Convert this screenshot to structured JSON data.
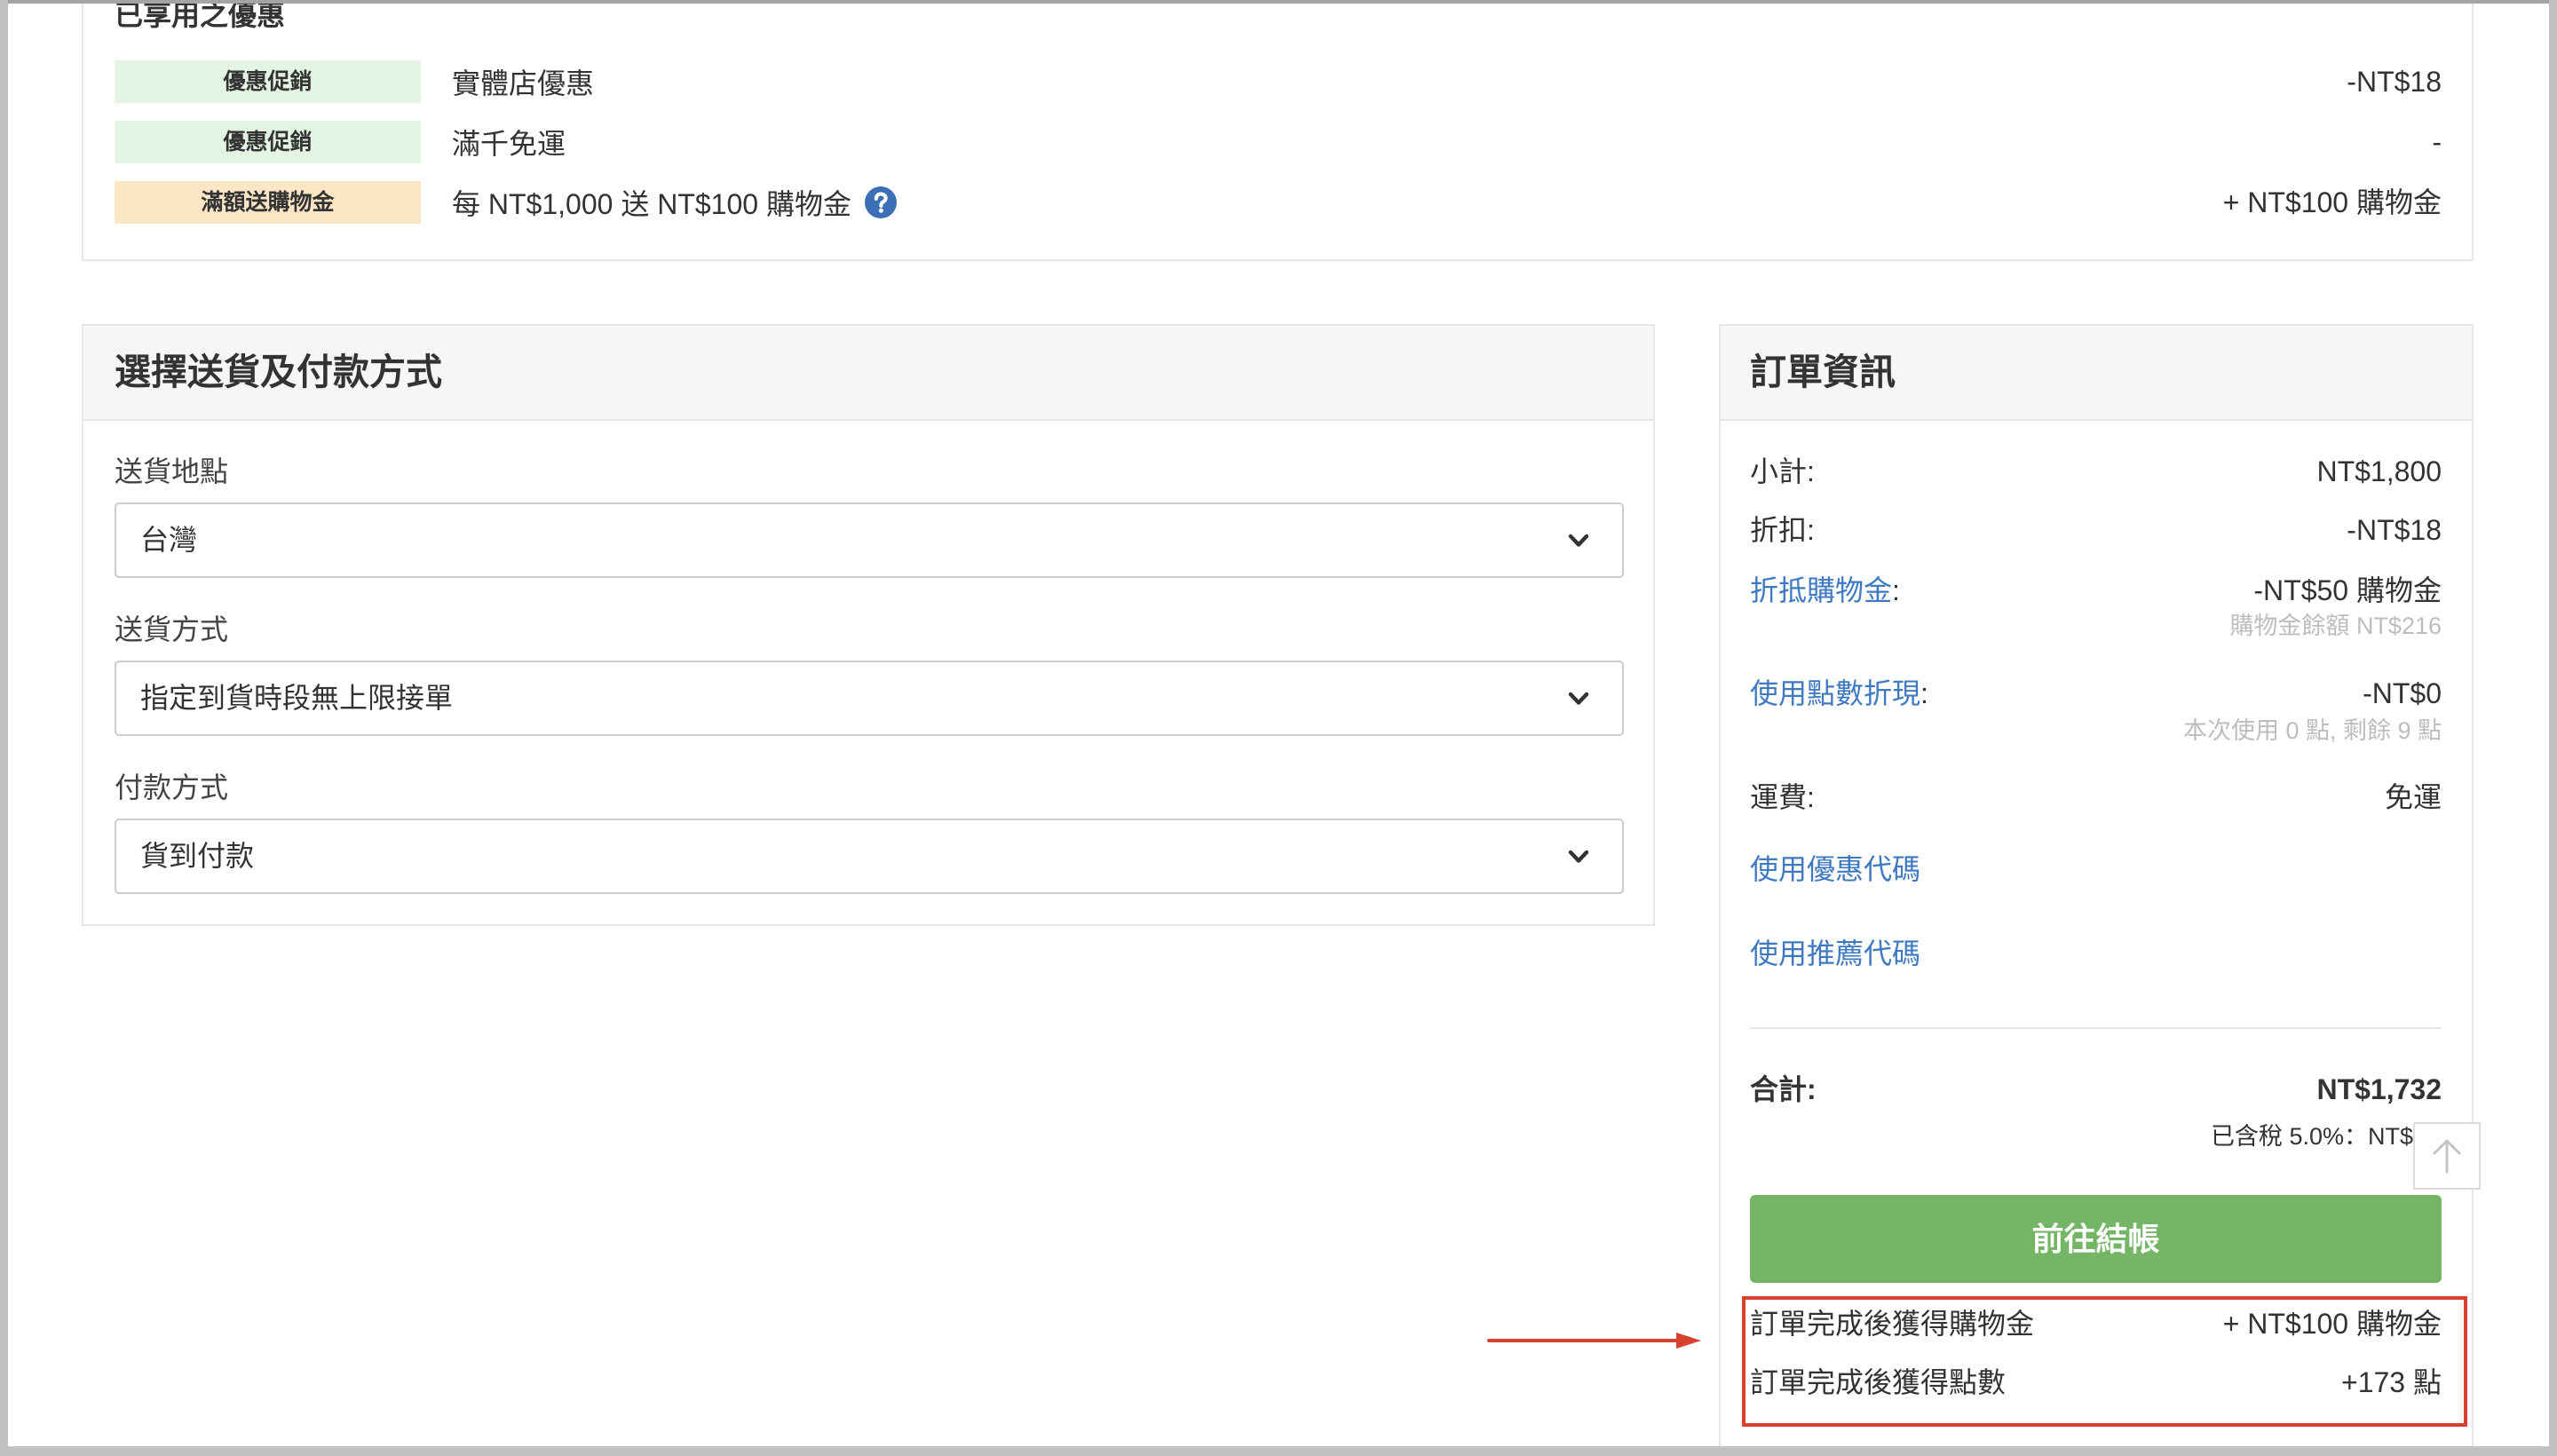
{
  "theme": {
    "link_color": "#3e79c2",
    "checkout_green": "#74b566",
    "highlight_red": "#d9412f"
  },
  "promotions": {
    "heading": "已享用之優惠",
    "items": [
      {
        "badge": "優惠促銷",
        "badge_color": "#e4f4e2",
        "name": "實體店優惠",
        "value": "-NT$18"
      },
      {
        "badge": "優惠促銷",
        "badge_color": "#e4f4e2",
        "name": "滿千免運",
        "value": "-"
      },
      {
        "badge": "滿額送購物金",
        "badge_color": "#fde6c6",
        "name": "每 NT$1,000 送 NT$100 購物金",
        "value": "+ NT$100 購物金",
        "icon": "question-circle-icon"
      }
    ]
  },
  "delivery_payment": {
    "title": "選擇送貨及付款方式",
    "fields": [
      {
        "label": "送貨地點",
        "value": "台灣",
        "icon": "chevron-down-icon"
      },
      {
        "label": "送貨方式",
        "value": "指定到貨時段無上限接單",
        "icon": "chevron-down-icon"
      },
      {
        "label": "付款方式",
        "value": "貨到付款",
        "icon": "chevron-down-icon"
      }
    ]
  },
  "order_summary": {
    "title": "訂單資訊",
    "subtotal": {
      "label": "小計:",
      "value": "NT$1,800"
    },
    "discount": {
      "label": "折扣:",
      "value": "-NT$18"
    },
    "store_credit": {
      "link": "折抵購物金",
      "suffix": ":",
      "value": "-NT$50 購物金",
      "note": "購物金餘額 NT$216"
    },
    "points": {
      "link": "使用點數折現",
      "suffix": ":",
      "value": "-NT$0",
      "note": "本次使用 0 點, 剩餘 9 點"
    },
    "shipping": {
      "label": "運費:",
      "value": "免運"
    },
    "coupon_link": "使用優惠代碼",
    "referral_link": "使用推薦代碼",
    "total": {
      "label": "合計:",
      "value": "NT$1,732"
    },
    "tax_note": "已含稅 5.0%：NT$",
    "checkout_button": "前往結帳",
    "rewards": [
      {
        "label": "訂單完成後獲得購物金",
        "value": "+ NT$100 購物金"
      },
      {
        "label": "訂單完成後獲得點數",
        "value": "+173 點"
      }
    ]
  },
  "scroll_top": {
    "icon": "arrow-up-icon"
  },
  "annotation": {
    "icon": "arrow-right-icon"
  }
}
